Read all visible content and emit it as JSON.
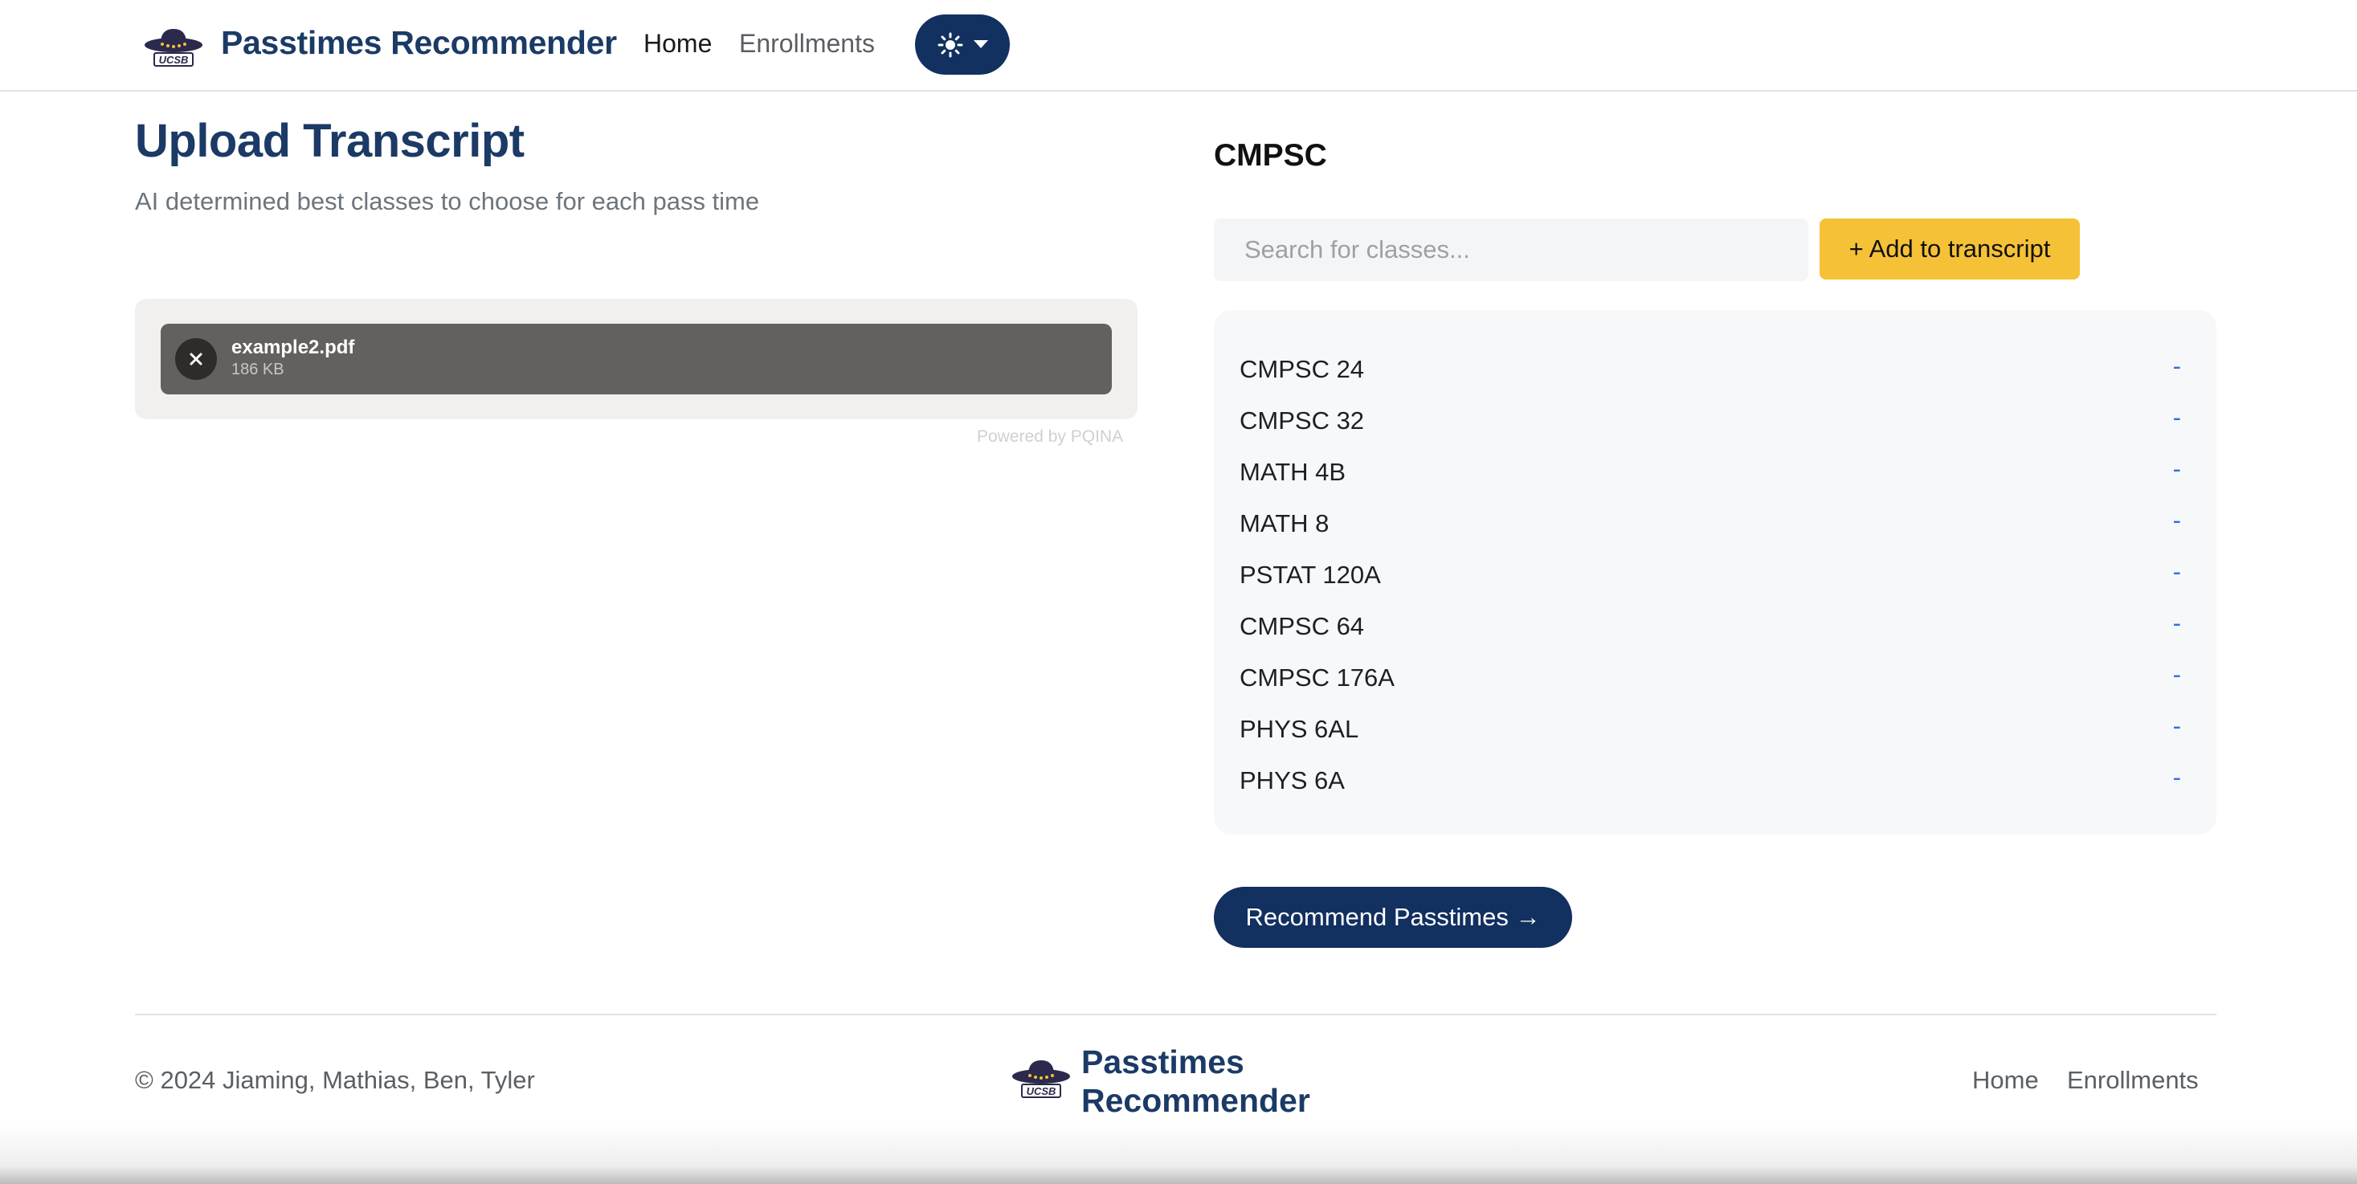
{
  "navbar": {
    "brand": "Passtimes Recommender",
    "links": [
      {
        "label": "Home"
      },
      {
        "label": "Enrollments"
      }
    ],
    "theme_toggle_icon": "sun-icon"
  },
  "main": {
    "title": "Upload Transcript",
    "subtitle": "AI determined best classes to choose for each pass time",
    "upload": {
      "file_name": "example2.pdf",
      "file_size": "186 KB",
      "powered_by": "Powered by PQINA"
    },
    "department": "CMPSC",
    "search": {
      "placeholder": "Search for classes...",
      "value": ""
    },
    "add_button": "+ Add to transcript",
    "classes": [
      {
        "name": "CMPSC 24",
        "action": "-"
      },
      {
        "name": "CMPSC 32",
        "action": "-"
      },
      {
        "name": "MATH 4B",
        "action": "-"
      },
      {
        "name": "MATH 8",
        "action": "-"
      },
      {
        "name": "PSTAT 120A",
        "action": "-"
      },
      {
        "name": "CMPSC 64",
        "action": "-"
      },
      {
        "name": "CMPSC 176A",
        "action": "-"
      },
      {
        "name": "PHYS 6AL",
        "action": "-"
      },
      {
        "name": "PHYS 6A",
        "action": "-"
      }
    ],
    "recommend_button": "Recommend Passtimes →"
  },
  "footer": {
    "copyright": "© 2024 Jiaming, Mathias, Ben, Tyler",
    "brand_line1": "Passtimes",
    "brand_line2": "Recommender",
    "links": [
      {
        "label": "Home"
      },
      {
        "label": "Enrollments"
      }
    ]
  },
  "colors": {
    "brand_navy": "#1b3a66",
    "button_navy": "#123060",
    "accent_yellow": "#f5c137",
    "link_blue": "#2f6fe0"
  }
}
